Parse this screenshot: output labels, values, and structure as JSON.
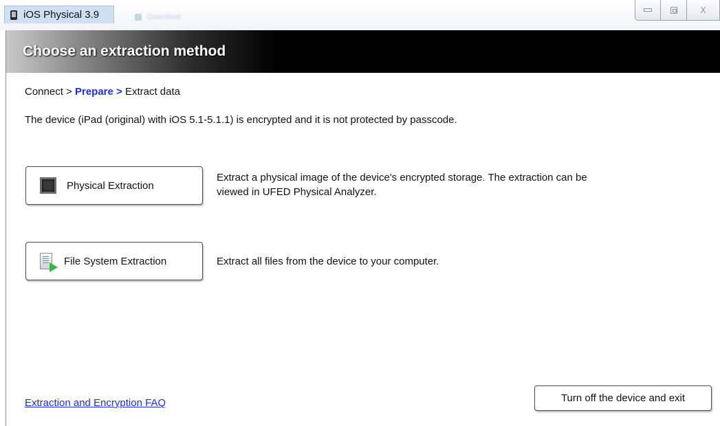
{
  "window": {
    "title": "iOS Physical 3.9",
    "background_tab_label": "Download",
    "controls": {
      "minimize": "minimize",
      "maximize": "maximize",
      "close": "X"
    }
  },
  "header": {
    "title": "Choose an extraction method"
  },
  "breadcrumb": {
    "step1": "Connect",
    "sep1": " > ",
    "step2": "Prepare >",
    "step3": " Extract data"
  },
  "status_message": "The device (iPad (original) with iOS 5.1-5.1.1) is encrypted and it is not protected by passcode.",
  "options": [
    {
      "label": "Physical Extraction",
      "icon": "chip-icon",
      "description_line1": "Extract a physical image of the device's encrypted storage. The extraction can be",
      "description_line2": "viewed in UFED Physical Analyzer."
    },
    {
      "label": "File System Extraction",
      "icon": "file-export-icon",
      "description_line1": "Extract all files from the device to your computer."
    }
  ],
  "footer": {
    "faq_link": "Extraction and Encryption FAQ",
    "exit_button": "Turn off the device and exit"
  },
  "colors": {
    "link": "#1b2fd6",
    "header_bg": "#000000",
    "accent": "#39b34a"
  }
}
